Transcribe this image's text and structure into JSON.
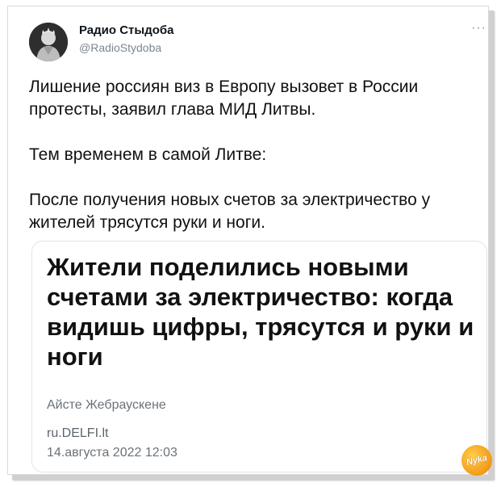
{
  "user": {
    "name": "Радио Стыдоба",
    "handle": "@RadioStydoba"
  },
  "tweet": {
    "paragraphs": [
      "Лишение россиян виз в Европу вызовет в России протесты, заявил глава МИД Литвы.",
      "Тем временем в самой Литве:",
      "После получения новых счетов за электричество у жителей трясутся руки и ноги."
    ]
  },
  "card": {
    "headline": "Жители поделились новыми счетами за электричество: когда видишь цифры, трясутся и руки и ноги",
    "author": "Айсте Жебраускене",
    "source": "ru.DELFI.lt",
    "date": "14.августа 2022 12:03"
  },
  "watermark": {
    "text": "Nyka"
  },
  "icons": {
    "more": "more-options-icon",
    "avatar": "profile-avatar"
  }
}
